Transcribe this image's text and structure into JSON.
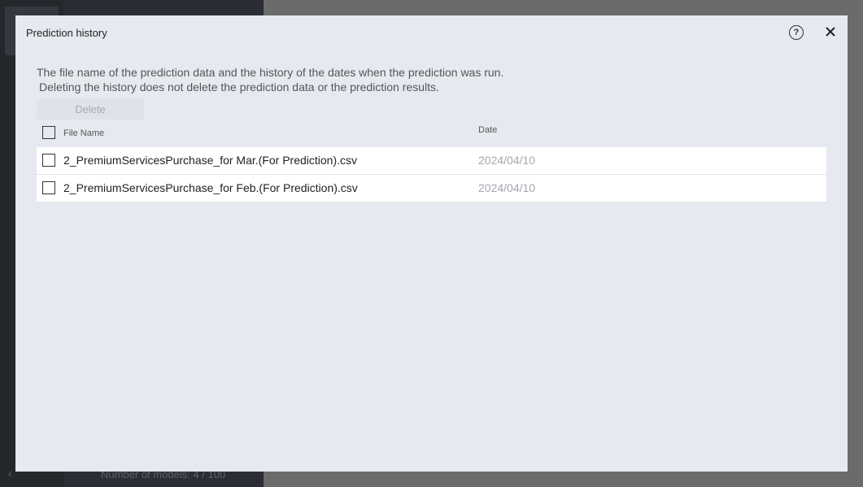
{
  "background": {
    "footer_text": "Number of models: 4 / 100",
    "back_icon": "chevron-left-icon"
  },
  "dialog": {
    "title": "Prediction history",
    "help_icon": "?",
    "close_icon": "close-icon",
    "description_line1": "The file name of the prediction data and the history of the dates when the prediction was run.",
    "description_line2": "Deleting the history does not delete the prediction data or the prediction results.",
    "delete_label": "Delete",
    "table": {
      "headers": {
        "file_name": "File Name",
        "date": "Date"
      },
      "rows": [
        {
          "file_name": "2_PremiumServicesPurchase_for Mar.(For Prediction).csv",
          "date": "2024/04/10",
          "checked": false
        },
        {
          "file_name": "2_PremiumServicesPurchase_for Feb.(For Prediction).csv",
          "date": "2024/04/10",
          "checked": false
        }
      ]
    }
  },
  "colors": {
    "overlay": "#6b6b6b",
    "modal_bg": "#e6e9ef",
    "row_bg": "#ffffff",
    "muted_text": "#a3a6ad"
  }
}
